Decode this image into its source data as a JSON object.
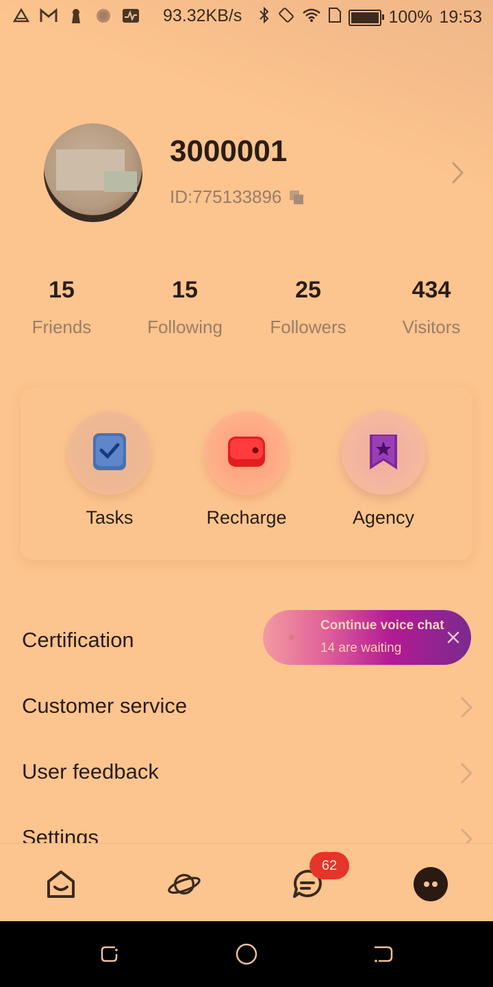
{
  "status_bar": {
    "speed": "93.32KB/s",
    "battery_percent": "100%",
    "time": "19:53",
    "left_icons": [
      "alert-icon",
      "gmail-icon",
      "keyhole-icon",
      "gear-dots-icon",
      "activity-icon"
    ],
    "right_icons": [
      "bluetooth-icon",
      "rotate-icon",
      "wifi-icon",
      "sim-icon",
      "battery-icon"
    ]
  },
  "profile": {
    "name": "3000001",
    "id_text": "ID:775133896"
  },
  "stats": [
    {
      "value": "15",
      "label": "Friends"
    },
    {
      "value": "15",
      "label": "Following"
    },
    {
      "value": "25",
      "label": "Followers"
    },
    {
      "value": "434",
      "label": "Visitors"
    }
  ],
  "quick_actions": [
    {
      "label": "Tasks",
      "icon": "checkbox-icon"
    },
    {
      "label": "Recharge",
      "icon": "wallet-icon"
    },
    {
      "label": "Agency",
      "icon": "bookmark-star-icon"
    }
  ],
  "menu": [
    {
      "label": "Certification"
    },
    {
      "label": "Customer service"
    },
    {
      "label": "User feedback"
    },
    {
      "label": "Settings"
    }
  ],
  "voice_chat_popup": {
    "title": "Continue voice chat",
    "subtitle": "14 are waiting"
  },
  "bottom_nav": {
    "items": [
      "home-icon",
      "planet-icon",
      "chat-icon",
      "me-icon"
    ],
    "chat_badge": "62",
    "active": "me"
  },
  "colors": {
    "background": "#fcc48e",
    "badge": "#e5352b",
    "text_primary": "#2a1d14",
    "text_secondary": "#9a7d66"
  }
}
